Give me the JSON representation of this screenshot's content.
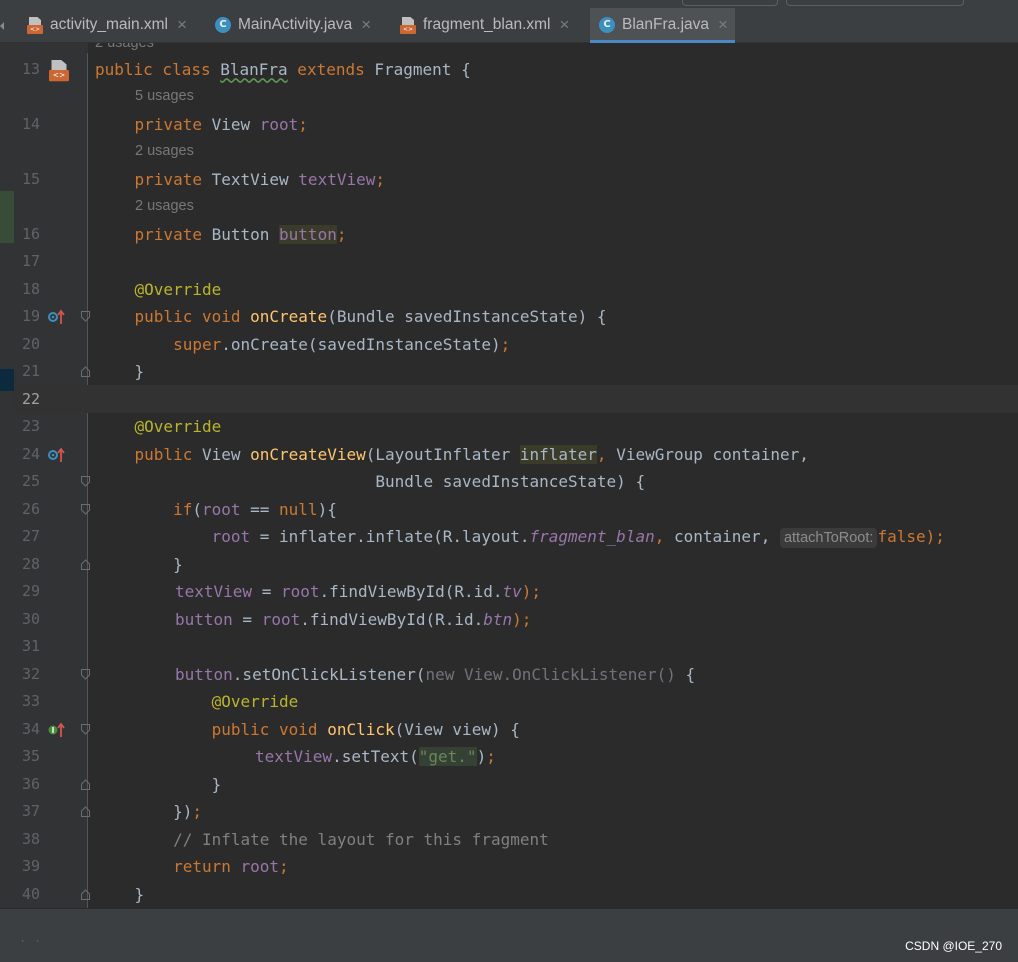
{
  "tabs": [
    {
      "label": "activity_main.xml",
      "icon": "xml-layout-icon",
      "active": false
    },
    {
      "label": "MainActivity.java",
      "icon": "class-icon",
      "active": false
    },
    {
      "label": "fragment_blan.xml",
      "icon": "xml-layout-icon",
      "active": false
    },
    {
      "label": "BlanFra.java",
      "icon": "class-icon",
      "active": true
    }
  ],
  "tab_close_glyph": "×",
  "class_icon_letter": "C",
  "xml_badge_text": "<>",
  "editor": {
    "top_partial_hint": "2 usages",
    "current_line": "22",
    "lines": {
      "l13": {
        "n": "13",
        "t1": "public class ",
        "t2": "BlanFra",
        "t3": " extends ",
        "t4": "Fragment {"
      },
      "h14": "5 usages",
      "l14": {
        "n": "14",
        "t1": "    private ",
        "t2": "View ",
        "t3": "root",
        ";": ";"
      },
      "h15": "2 usages",
      "l15": {
        "n": "15",
        "t1": "    private ",
        "t2": "TextView ",
        "t3": "textView",
        "t4": ";"
      },
      "h16": "2 usages",
      "l16": {
        "n": "16",
        "t1": "    private ",
        "t2": "Button ",
        "t3": "button",
        "t4": ";"
      },
      "l17": {
        "n": "17"
      },
      "l18": {
        "n": "18",
        "t1": "    @Override"
      },
      "l19": {
        "n": "19",
        "t1": "    public void ",
        "t2": "onCreate",
        "t3": "(Bundle savedInstanceState) {"
      },
      "l20": {
        "n": "20",
        "t1": "        super",
        "t2": ".onCreate(savedInstanceState)",
        "t3": ";"
      },
      "l21": {
        "n": "21",
        "t1": "    }"
      },
      "l22": {
        "n": "22"
      },
      "l23": {
        "n": "23",
        "t1": "    @Override"
      },
      "l24": {
        "n": "24",
        "t1": "    public ",
        "t2": "View ",
        "t3": "onCreateView",
        "t4": "(LayoutInflater ",
        "t5": "inflater",
        ",": ",",
        "t6": " ViewGroup container,"
      },
      "l25": {
        "n": "25",
        "t1": "                             Bundle savedInstanceState) {"
      },
      "l26": {
        "n": "26",
        "t1": "        if",
        "t2": "(",
        "t3": "root",
        " ==": " == ",
        "t4": "null",
        "t5": "){"
      },
      "l27": {
        "n": "27",
        "t1": "            ",
        "t2": "root",
        " =": " = inflater.inflate(R.layout.",
        "t3": "fragment_blan",
        ",": ",",
        "t4": " container, ",
        "inlay": "attachToRoot:",
        "t5": "false",
        ");": ");"
      },
      "l28": {
        "n": "28",
        "t1": "        }"
      },
      "l29": {
        "n": "29",
        "t2": "textView",
        " =": " = ",
        "t3": "root",
        "t4": ".findViewById(R.id.",
        "t5": "tv",
        ");": ");"
      },
      "l30": {
        "n": "30",
        "t2": "button",
        " =": " = ",
        "t3": "root",
        "t4": ".findViewById(R.id.",
        "t5": "btn",
        ");": ");"
      },
      "l31": {
        "n": "31"
      },
      "l32": {
        "n": "32",
        "t2": "button",
        "t3": ".setOnClickListener(",
        "t4": "new View.OnClickListener() ",
        "t5": "{"
      },
      "l33": {
        "n": "33",
        "t1": "            @Override"
      },
      "l34": {
        "n": "34",
        "t1": "            public void ",
        "t2": "onClick",
        "t3": "(View view) {"
      },
      "l35": {
        "n": "35",
        "t2": "textView",
        "t3": ".setText(",
        "t4": "\"get.\"",
        "t5": ")",
        ";": ";"
      },
      "l36": {
        "n": "36",
        "t1": "            }"
      },
      "l37": {
        "n": "37",
        "t1": "        })",
        ";": ";"
      },
      "l38": {
        "n": "38",
        "t1": "        // Inflate the layout for this fragment"
      },
      "l39": {
        "n": "39",
        "t1": "        return ",
        "t2": "root",
        ";": ";"
      },
      "l40": {
        "n": "40",
        "t1": "    }"
      }
    }
  },
  "watermark": "CSDN @IOE_270",
  "colors": {
    "background": "#2b2b2b",
    "keyword": "#cc7832",
    "field": "#9876aa",
    "annotation": "#bbb529",
    "method": "#ffc66d",
    "string": "#6a8759",
    "comment": "#808080",
    "tab_active_underline": "#4a88c7"
  }
}
